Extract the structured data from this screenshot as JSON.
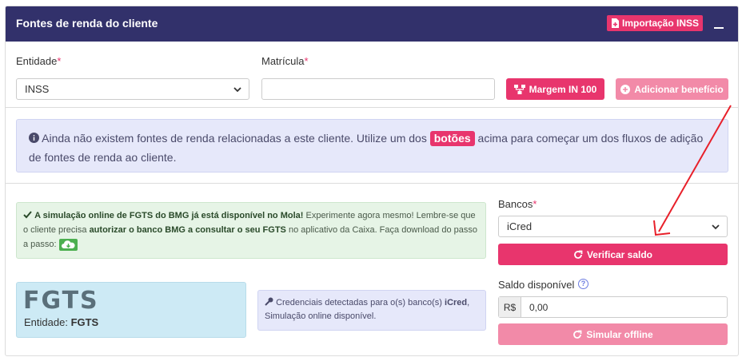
{
  "header": {
    "title": "Fontes de renda do cliente",
    "import_button": "Importação INSS"
  },
  "form": {
    "entidade_label": "Entidade",
    "entidade_value": "INSS",
    "matricula_label": "Matrícula",
    "matricula_value": "",
    "required_mark": "*",
    "margem_button": "Margem IN 100",
    "add_button": "Adicionar benefício"
  },
  "info": {
    "text_before": "Ainda não existem fontes de renda relacionadas a este cliente. Utilize um dos",
    "pill": "botões",
    "text_after": "acima para começar um dos fluxos de adição de fontes de renda ao cliente."
  },
  "fgts_notice": {
    "bold1": "A simulação online de FGTS do BMG já está disponível no Mola!",
    "text1": "Experimente agora mesmo! Lembre-se que o cliente precisa",
    "bold2": "autorizar o banco BMG a consultar o seu FGTS",
    "text2": "no aplicativo da Caixa. Faça download do passo a passo:"
  },
  "fgts_card": {
    "logo_text": "FGTS",
    "entity_label": "Entidade:",
    "entity_value": "FGTS"
  },
  "credentials": {
    "text1": "Credenciais detectadas para o(s) banco(s)",
    "bank": "iCred",
    "text2": ",",
    "text3": "Simulação online disponível."
  },
  "bancos": {
    "label": "Bancos",
    "selected": "iCred",
    "verify_button": "Verificar saldo"
  },
  "saldo": {
    "label": "Saldo disponível",
    "prefix": "R$",
    "value": "0,00",
    "simulate_button": "Simular offline"
  },
  "colors": {
    "header_bg": "#32316b",
    "accent": "#e8356d",
    "accent_light": "#f28aa8",
    "arrow": "#e8202a"
  }
}
